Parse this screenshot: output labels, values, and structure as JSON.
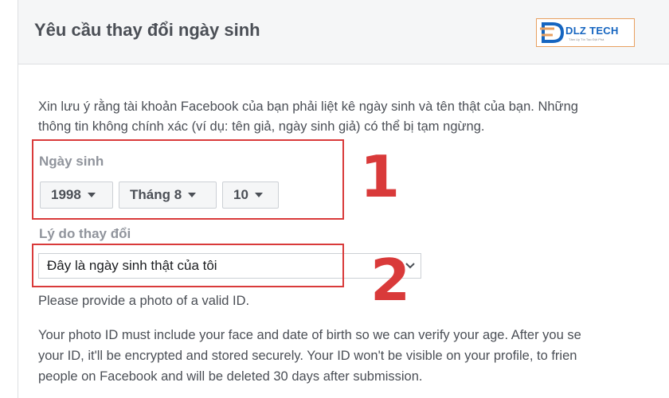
{
  "header": {
    "title": "Yêu cầu thay đổi ngày sinh",
    "logo_text": "DLZ TECH",
    "logo_tagline": "Tâm Uy Tín Tạo Đột Phá"
  },
  "intro": {
    "line1": "Xin lưu ý rằng tài khoản Facebook của bạn phải liệt kê ngày sinh và tên thật của bạn. Những",
    "line2": "thông tin không chính xác (ví dụ: tên giả, ngày sinh giả) có thể bị tạm ngừng."
  },
  "birthday": {
    "label": "Ngày sinh",
    "year": "1998",
    "month": "Tháng 8",
    "day": "10"
  },
  "reason": {
    "label": "Lý do thay đổi",
    "selected": "Đây là ngày sinh thật của tôi"
  },
  "photo_prompt": "Please provide a photo of a valid ID.",
  "photo_info": {
    "line1": "Your photo ID must include your face and date of birth so we can verify your age. After you se",
    "line2": "your ID, it'll be encrypted and stored securely. Your ID won't be visible on your profile, to frien",
    "line3": "people on Facebook and will be deleted 30 days after submission."
  },
  "annotations": {
    "marker1": "1",
    "marker2": "2",
    "color": "#d93a3a"
  }
}
